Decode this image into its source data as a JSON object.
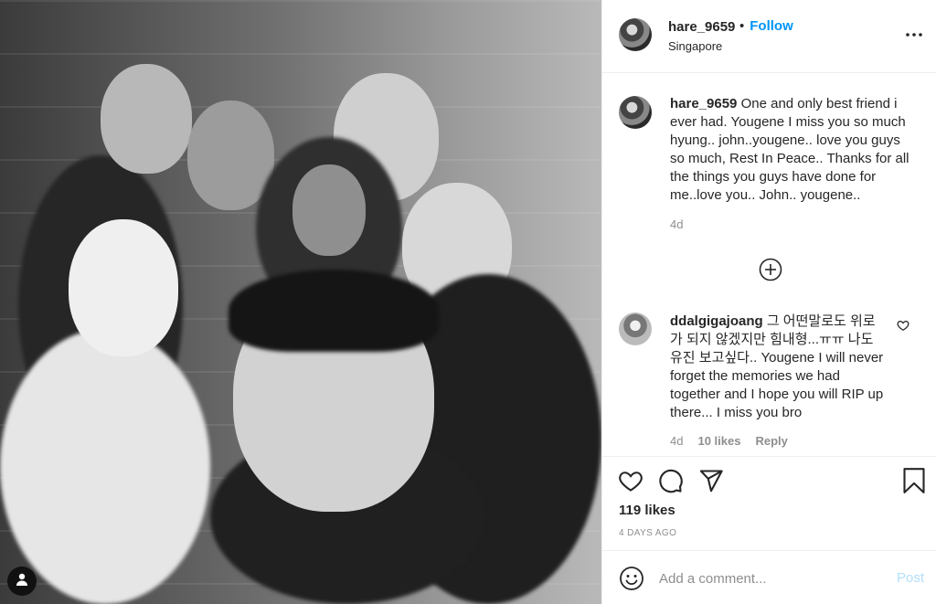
{
  "post": {
    "username": "hare_9659",
    "separator": "•",
    "follow_label": "Follow",
    "location": "Singapore",
    "more_icon": "more-horizontal-icon"
  },
  "caption": {
    "username": "hare_9659",
    "text": "One and only best friend i ever had. Yougene I miss you so much hyung.. john..yougene.. love you guys so much, Rest In Peace.. Thanks for all the things you guys have done for me..love you.. John.. yougene..",
    "time": "4d"
  },
  "comment": {
    "username": "ddalgigajoang",
    "text": "그 어떤말로도 위로가 되지 않겠지만 힘내형...ㅠㅠ 나도 유진 보고싶다.. Yougene I will never forget the memories we had together and I hope you will RIP up there... I miss you bro",
    "time": "4d",
    "likes": "10 likes",
    "reply_label": "Reply"
  },
  "actions": {
    "likes": "119 likes",
    "date": "4 DAYS AGO"
  },
  "add_comment": {
    "placeholder": "Add a comment...",
    "post_label": "Post"
  },
  "colors": {
    "accent": "#0095f6",
    "muted": "#8e8e8e",
    "post_disabled": "#b2dffc"
  }
}
